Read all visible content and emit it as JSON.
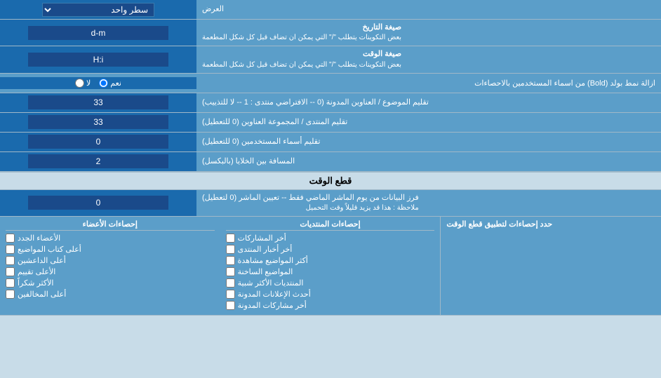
{
  "page": {
    "title": "العرض",
    "rows": [
      {
        "id": "display_mode",
        "label": "العرض",
        "input_type": "select",
        "value": "سطر واحد"
      },
      {
        "id": "date_format",
        "label": "صيغة التاريخ",
        "sublabel": "بعض التكوينات يتطلب \"/\" التي يمكن ان تضاف قبل كل شكل المطعمة",
        "input_type": "text",
        "value": "d-m"
      },
      {
        "id": "time_format",
        "label": "صيغة الوقت",
        "sublabel": "بعض التكوينات يتطلب \"/\" التي يمكن ان تضاف قبل كل شكل المطعمة",
        "input_type": "text",
        "value": "H:i"
      },
      {
        "id": "bold_remove",
        "label": "ازالة نمط بولد (Bold) من اسماء المستخدمين بالاحصاءات",
        "input_type": "radio",
        "options": [
          "نعم",
          "لا"
        ],
        "selected": "نعم"
      },
      {
        "id": "forum_subjects",
        "label": "تقليم الموضوع / العناوين المدونة (0 -- الافتراضي منتدى : 1 -- لا للتذييب)",
        "input_type": "text",
        "value": "33"
      },
      {
        "id": "forum_trim",
        "label": "تقليم المنتدى / المجموعة العناوين (0 للتعطيل)",
        "input_type": "text",
        "value": "33"
      },
      {
        "id": "users_trim",
        "label": "تقليم أسماء المستخدمين (0 للتعطيل)",
        "input_type": "text",
        "value": "0"
      },
      {
        "id": "cell_spacing",
        "label": "المسافة بين الخلايا (بالبكسل)",
        "input_type": "text",
        "value": "2"
      }
    ],
    "cutoff_section": {
      "title": "قطع الوقت",
      "row": {
        "id": "cutoff_days",
        "label": "فرز البيانات من يوم الماشر الماضي فقط -- تعيين الماشر (0 لتعطيل)",
        "note": "ملاحظة : هذا قد يزيد قليلاً وقت التحميل",
        "input_type": "text",
        "value": "0"
      }
    },
    "stats_section": {
      "title": "حدد إحصاءات لتطبيق قطع الوقت",
      "col1_header": "إحصاءات المنتديات",
      "col1_items": [
        "أخر المشاركات",
        "أخر أخبار المنتدى",
        "أكثر المواضيع مشاهدة",
        "المواضيع الساخنة",
        "المنتديات الأكثر شبية",
        "أحدث الإعلانات المدونة",
        "أخر مشاركات المدونة"
      ],
      "col2_header": "إحصاءات الأعضاء",
      "col2_items": [
        "الأعضاء الجدد",
        "أعلى كتاب المواضيع",
        "أعلى الداعشين",
        "الأعلى تقييم",
        "الأكثر شكراً",
        "أعلى المخالفين"
      ]
    }
  }
}
